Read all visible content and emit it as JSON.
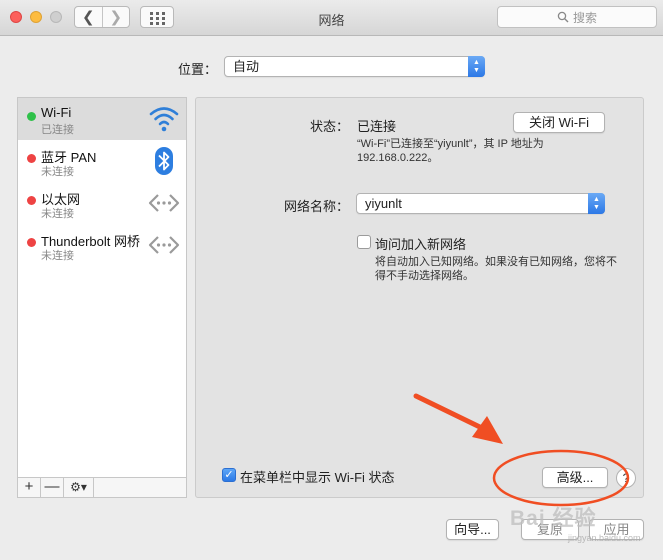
{
  "window": {
    "title": "网络"
  },
  "search": {
    "placeholder": "搜索"
  },
  "location": {
    "label": "位置：",
    "value": "自动"
  },
  "services": [
    {
      "name": "Wi-Fi",
      "status": "已连接",
      "status_color": "#2fc14a",
      "icon": "wifi-icon"
    },
    {
      "name": "蓝牙 PAN",
      "status": "未连接",
      "status_color": "#ee4343",
      "icon": "bluetooth-icon"
    },
    {
      "name": "以太网",
      "status": "未连接",
      "status_color": "#ee4343",
      "icon": "ethernet-icon"
    },
    {
      "name": "Thunderbolt 网桥",
      "status": "未连接",
      "status_color": "#ee4343",
      "icon": "ethernet-icon"
    }
  ],
  "sidebar_toolbar": {
    "add": "+",
    "remove": "—"
  },
  "detail": {
    "status_label": "状态：",
    "status_value": "已连接",
    "turn_off_button": "关闭 Wi-Fi",
    "status_desc_line1": "“Wi-Fi”已连接至“yiyunlt”，其 IP 地址为",
    "status_desc_line2": "192.168.0.222。",
    "network_name_label": "网络名称：",
    "network_name_value": "yiyunlt",
    "ask_join_label": "询问加入新网络",
    "ask_join_checked": false,
    "ask_join_desc_line1": "将自动加入已知网络。如果没有已知网络，您将不",
    "ask_join_desc_line2": "得不手动选择网络。",
    "show_menubar_label": "在菜单栏中显示 Wi-Fi 状态",
    "show_menubar_checked": true,
    "advanced_button": "高级...",
    "help": "?"
  },
  "footer": {
    "assist_button": "向导...",
    "revert_button": "复原",
    "apply_button": "应用"
  },
  "annotation": {
    "color": "#f04e23"
  },
  "watermark": {
    "text": "Bai 经验",
    "sub": "jingyan.baidu.com"
  }
}
